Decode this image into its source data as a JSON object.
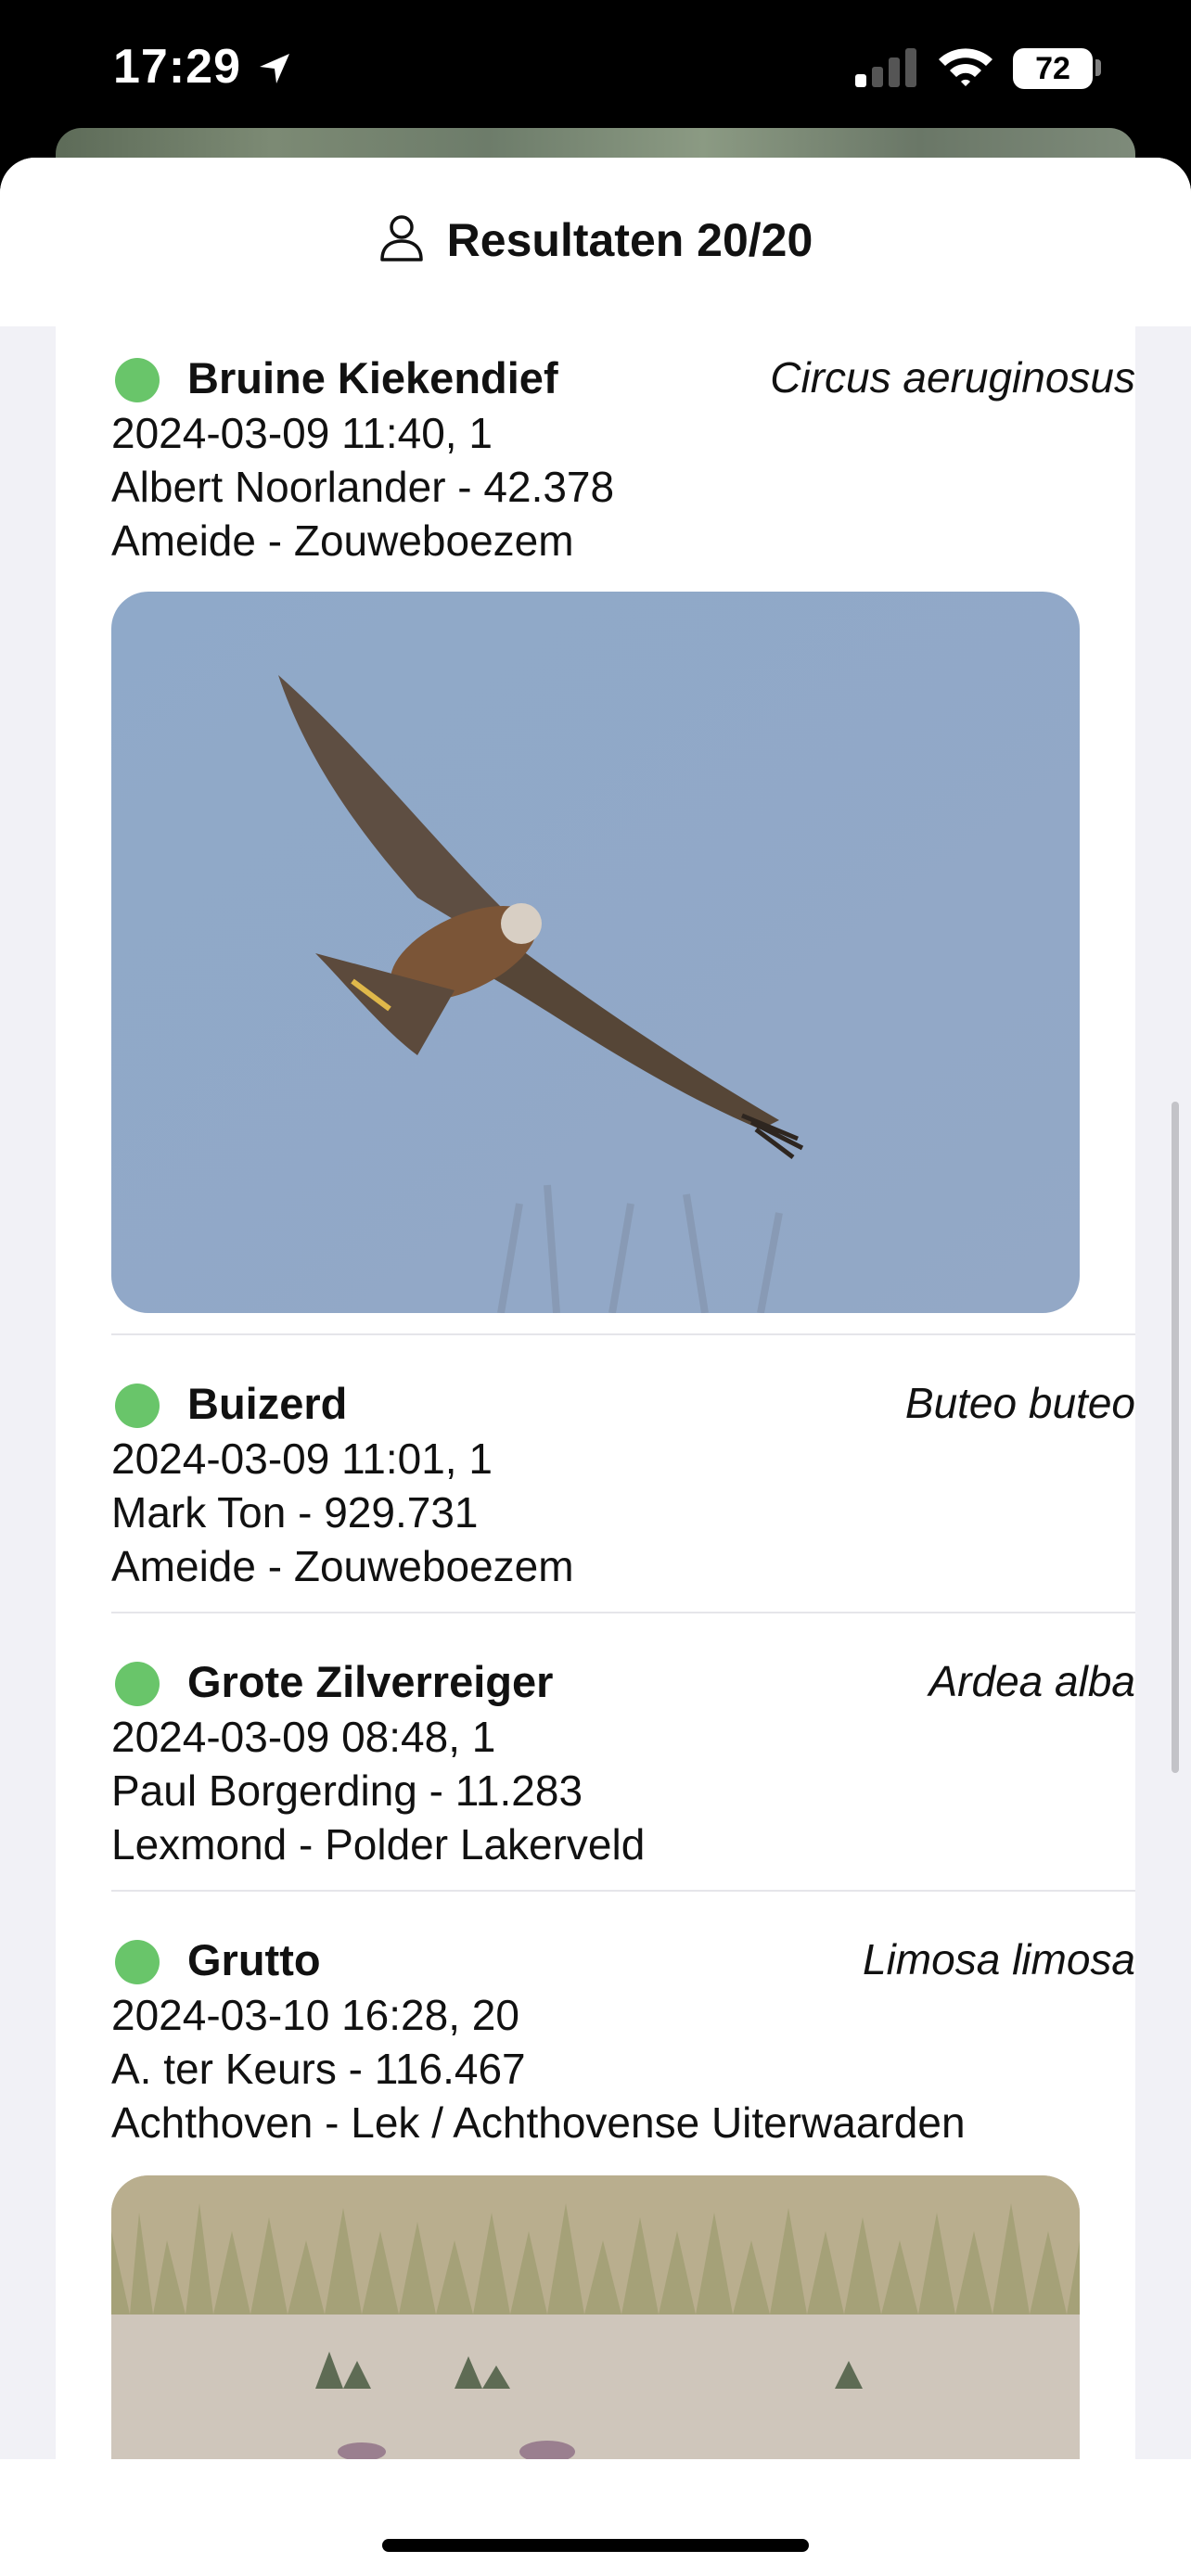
{
  "status_bar": {
    "time": "17:29",
    "battery": "72",
    "icons": [
      "location-arrow-icon",
      "cellular-signal-icon",
      "wifi-icon",
      "battery-icon"
    ]
  },
  "header": {
    "icon": "person-icon",
    "title": "Resultaten 20/20"
  },
  "colors": {
    "status_dot": "#69c56a",
    "list_background": "#f1f1f6",
    "divider": "#e5e5ea"
  },
  "observations": [
    {
      "name": "Bruine Kiekendief",
      "scientific_name": "Circus aeruginosus",
      "datetime_count": "2024-03-09 11:40, 1",
      "observer": "Albert Noorlander - 42.378",
      "location": "Ameide - Zouweboezem",
      "has_photo": true
    },
    {
      "name": "Buizerd",
      "scientific_name": "Buteo buteo",
      "datetime_count": "2024-03-09 11:01, 1",
      "observer": "Mark Ton - 929.731",
      "location": "Ameide - Zouweboezem",
      "has_photo": false
    },
    {
      "name": "Grote Zilverreiger",
      "scientific_name": "Ardea alba",
      "datetime_count": "2024-03-09 08:48, 1",
      "observer": "Paul Borgerding - 11.283",
      "location": "Lexmond - Polder Lakerveld",
      "has_photo": false
    },
    {
      "name": "Grutto",
      "scientific_name": "Limosa limosa",
      "datetime_count": "2024-03-10 16:28, 20",
      "observer": "A. ter Keurs - 116.467",
      "location": "Achthoven - Lek / Achthovense Uiterwaarden",
      "has_photo": true
    }
  ]
}
